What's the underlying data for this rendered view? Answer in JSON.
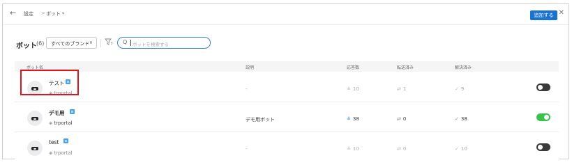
{
  "topbar": {
    "back_icon": "←",
    "breadcrumb": [
      "設定",
      ">",
      "ボット"
    ],
    "dropdown_caret": "▾",
    "close_icon": "✕"
  },
  "header": {
    "title": "ボット",
    "count": "(6)",
    "brand_select": "すべてのブランド",
    "brand_chevron": "∨",
    "filter_icon": "filter-icon",
    "search_icon": "Q",
    "search_placeholder": "ボットを検索する",
    "add_button": "追加する"
  },
  "columns": [
    "ボット名",
    "説明",
    "応答数",
    "転送済み",
    "解決済み"
  ],
  "rows": [
    {
      "name": "テスト",
      "brand": "trportal",
      "description": "-",
      "responses": "10",
      "transferred": "1",
      "resolved": "9",
      "enabled": false,
      "highlighted": true
    },
    {
      "name": "デモ用",
      "brand": "trportal",
      "description": "デモ用ボット",
      "responses": "38",
      "transferred": "0",
      "resolved": "38",
      "enabled": true,
      "highlighted": false
    },
    {
      "name": "test",
      "brand": "trportal",
      "description": "-",
      "responses": "10",
      "transferred": "0",
      "resolved": "10",
      "enabled": false,
      "highlighted": false
    }
  ],
  "icons": {
    "responses": "≗",
    "transferred": "⇄",
    "resolved": "✓",
    "brand": "◈"
  },
  "colors": {
    "accent": "#1a73d1",
    "toggle_on": "#39c24c",
    "toggle_off": "#3a3a3a",
    "highlight": "#e0141b",
    "bot_icon": "#4aa3e6"
  }
}
